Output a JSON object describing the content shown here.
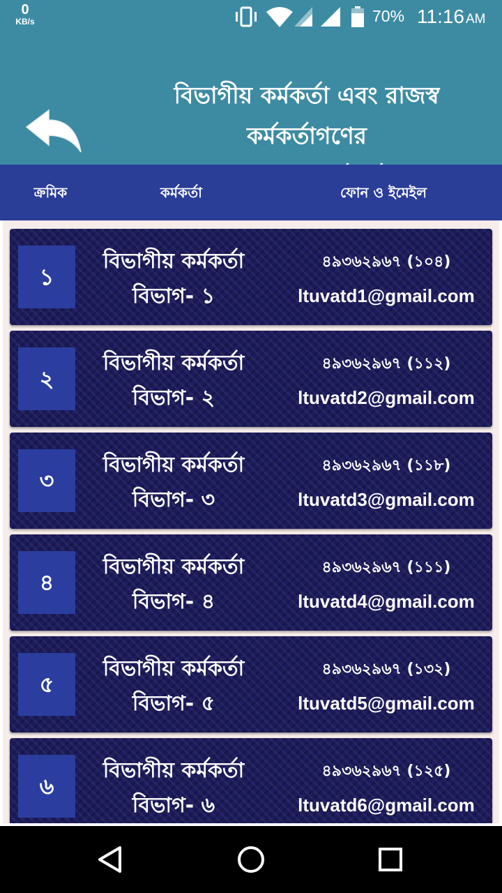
{
  "status_bar": {
    "net_speed_value": "0",
    "net_speed_unit": "KB/s",
    "battery_percent": "70%",
    "time": "11:16",
    "ampm": "AM",
    "icons": [
      "vibrate-icon",
      "wifi-icon",
      "signal-icon",
      "signal-icon",
      "battery-icon"
    ]
  },
  "header": {
    "title_lines": [
      "বিভাগীয় কর্মকর্তা এবং রাজস্ব",
      "কর্মকর্তাগণের",
      "ফোন নাম্বার ও ইমেইল"
    ],
    "back_icon": "back-arrow-icon"
  },
  "columns": {
    "serial": "ক্রমিক",
    "officer": "কর্মকর্তা",
    "contact": "ফোন ও ইমেইল"
  },
  "rows": [
    {
      "serial": "১",
      "title": "বিভাগীয় কর্মকর্তা",
      "division": "বিভাগ- ১",
      "phone": "৪৯৩৬২৯৬৭ (১০৪)",
      "email": "ltuvatd1@gmail.com"
    },
    {
      "serial": "২",
      "title": "বিভাগীয় কর্মকর্তা",
      "division": "বিভাগ- ২",
      "phone": "৪৯৩৬২৯৬৭ (১১২)",
      "email": "ltuvatd2@gmail.com"
    },
    {
      "serial": "৩",
      "title": "বিভাগীয় কর্মকর্তা",
      "division": "বিভাগ- ৩",
      "phone": "৪৯৩৬২৯৬৭ (১১৮)",
      "email": "ltuvatd3@gmail.com"
    },
    {
      "serial": "৪",
      "title": "বিভাগীয় কর্মকর্তা",
      "division": "বিভাগ- ৪",
      "phone": "৪৯৩৬২৯৬৭ (১১১)",
      "email": "ltuvatd4@gmail.com"
    },
    {
      "serial": "৫",
      "title": "বিভাগীয় কর্মকর্তা",
      "division": "বিভাগ- ৫",
      "phone": "৪৯৩৬২৯৬৭ (১৩২)",
      "email": "ltuvatd5@gmail.com"
    },
    {
      "serial": "৬",
      "title": "বিভাগীয় কর্মকর্তা",
      "division": "বিভাগ- ৬",
      "phone": "৪৯৩৬২৯৬৭ (১২৫)",
      "email": "ltuvatd6@gmail.com"
    }
  ],
  "nav_bar": {
    "icons": [
      "back-triangle-icon",
      "home-circle-icon",
      "recents-square-icon"
    ]
  },
  "colors": {
    "header_bg": "#3d8ba3",
    "column_bar_bg": "#2a3d97",
    "card_bg": "#1c1b5c",
    "serial_box_bg": "#2b3ea0",
    "list_bg": "#f6ecea"
  }
}
